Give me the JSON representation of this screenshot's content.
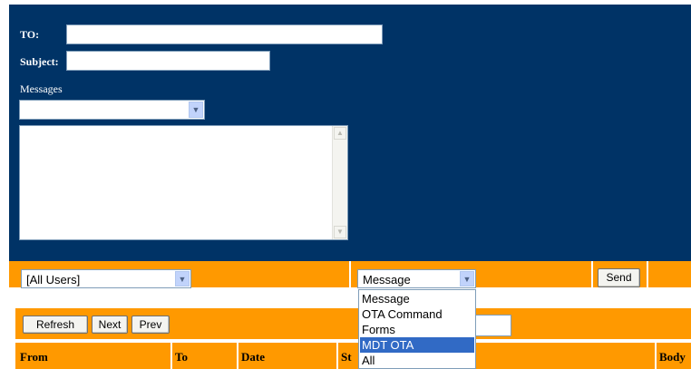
{
  "compose": {
    "to_label": "TO:",
    "to_value": "",
    "subject_label": "Subject:",
    "subject_value": "",
    "messages_label": "Messages",
    "messages_select_value": "",
    "body_value": ""
  },
  "send_bar": {
    "user_select_value": "[All Users]",
    "type_select_value": "Message",
    "send_label": "Send"
  },
  "type_dropdown": {
    "options": [
      "Message",
      "OTA Command",
      "Forms",
      "MDT OTA",
      "All"
    ],
    "highlighted": "MDT OTA"
  },
  "list_toolbar": {
    "refresh_label": "Refresh",
    "next_label": "Next",
    "prev_label": "Prev",
    "search_value": ""
  },
  "table": {
    "headers": [
      "From",
      "To",
      "Date",
      "St",
      "Body"
    ]
  },
  "colors": {
    "panel": "#003366",
    "bar": "#ff9900",
    "highlight": "#316ac5"
  },
  "icons": {
    "select_arrow": "chevron-down-icon",
    "scroll_up": "scroll-up-icon",
    "scroll_down": "scroll-down-icon"
  }
}
